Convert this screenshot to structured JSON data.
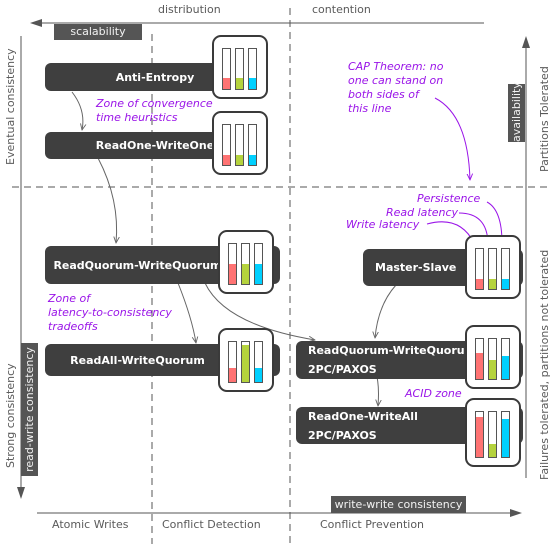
{
  "top_axis": {
    "left_label": "distribution",
    "right_label": "contention",
    "tag": "scalability"
  },
  "bottom_axis": {
    "columns": [
      "Atomic Writes",
      "Conflict Detection",
      "Conflict Prevention"
    ],
    "tag": "write-write consistency"
  },
  "left_axis": {
    "top_label": "Eventual consistency",
    "bottom_label": "Strong consistency",
    "tag": "read-write consistency"
  },
  "right_axis": {
    "top_label": "Partitions Tolerated",
    "bottom_label": "Failures tolerated, partitions not tolerated",
    "tag": "availability"
  },
  "colors": {
    "write_latency": "#ff7373",
    "read_latency": "#b5d33d",
    "persistence": "#00d0ff",
    "annotation": "#9a14e8",
    "node": "#3f3f3f",
    "tag": "#555555"
  },
  "nodes": [
    {
      "id": "anti-entropy",
      "lines": [
        "Anti-Entropy"
      ],
      "bars": {
        "write_latency": 0.27,
        "read_latency": 0.27,
        "persistence": 0.27
      }
    },
    {
      "id": "readone-writeone",
      "lines": [
        "ReadOne-WriteOne"
      ],
      "bars": {
        "write_latency": 0.25,
        "read_latency": 0.25,
        "persistence": 0.25
      }
    },
    {
      "id": "readquorum-writequorum",
      "lines": [
        "ReadQuorum-WriteQuorum"
      ],
      "bars": {
        "write_latency": 0.5,
        "read_latency": 0.5,
        "persistence": 0.5
      }
    },
    {
      "id": "readall-writequorum",
      "lines": [
        "ReadAll-WriteQuorum"
      ],
      "bars": {
        "write_latency": 0.35,
        "read_latency": 0.93,
        "persistence": 0.35
      }
    },
    {
      "id": "master-slave",
      "lines": [
        "Master-Slave"
      ],
      "bars": {
        "write_latency": 0.25,
        "read_latency": 0.25,
        "persistence": 0.25
      }
    },
    {
      "id": "rq-wq-2pc",
      "lines": [
        "ReadQuorum-WriteQuorum",
        "2PC/PAXOS"
      ],
      "bars": {
        "write_latency": 0.65,
        "read_latency": 0.48,
        "persistence": 0.57
      }
    },
    {
      "id": "readone-writeall-2pc",
      "lines": [
        "ReadOne-WriteAll",
        "2PC/PAXOS"
      ],
      "bars": {
        "write_latency": 0.9,
        "read_latency": 0.28,
        "persistence": 0.85
      }
    }
  ],
  "annotations": {
    "convergence": [
      "Zone of convergence",
      "time heuristics"
    ],
    "latency_tradeoffs": [
      "Zone of",
      "latency-to-consistency",
      "tradeoffs"
    ],
    "cap": [
      "CAP Theorem: no",
      "one can stand on",
      "both sides of",
      "this line"
    ],
    "persistence": "Persistence",
    "read_latency": "Read latency",
    "write_latency": "Write latency",
    "acid": "ACID zone"
  }
}
